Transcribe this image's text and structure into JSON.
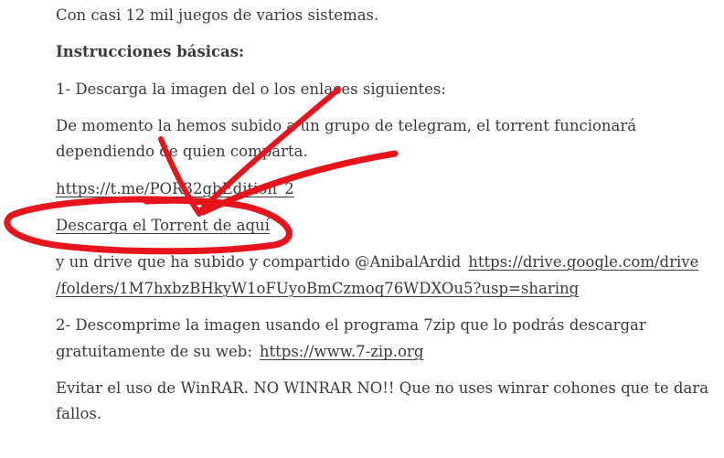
{
  "article": {
    "intro": "Con casi 12 mil juegos de varios sistemas.",
    "heading": "Instrucciones básicas:",
    "step1": "1- Descarga la imagen del o los enlaces siguientes:",
    "moment_line1": "De momento la hemos subido a un grupo de telegram, el torrent funcionará",
    "moment_line2": "dependiendo de quien comparta.",
    "telegram_link": "https://t.me/POR32gbEdition_2",
    "torrent_link": "Descarga el Torrent de aquí",
    "drive_text": "y un drive que ha subido y compartido @AnibalArdid",
    "drive_link_part1": "https://drive.google.com/drive",
    "drive_link_part2": "/folders/1M7hxbzBHkyW1oFUyoBmCzmoq76WDXOu5?usp=sharing",
    "step2_line1": "2- Descomprime la imagen usando el programa 7zip que lo podrás descargar",
    "step2_line2_text": "gratuitamente de su web:",
    "zip_link": "https://www.7-zip.org",
    "winrar_line1": "Evitar el uso de WinRAR. NO WINRAR NO!! Que no uses winrar cohones que te dara",
    "winrar_line2": "fallos."
  },
  "annotation": {
    "color": "#e8141c",
    "shape": "hand-drawn circle with two arrows pointing at the torrent link"
  }
}
